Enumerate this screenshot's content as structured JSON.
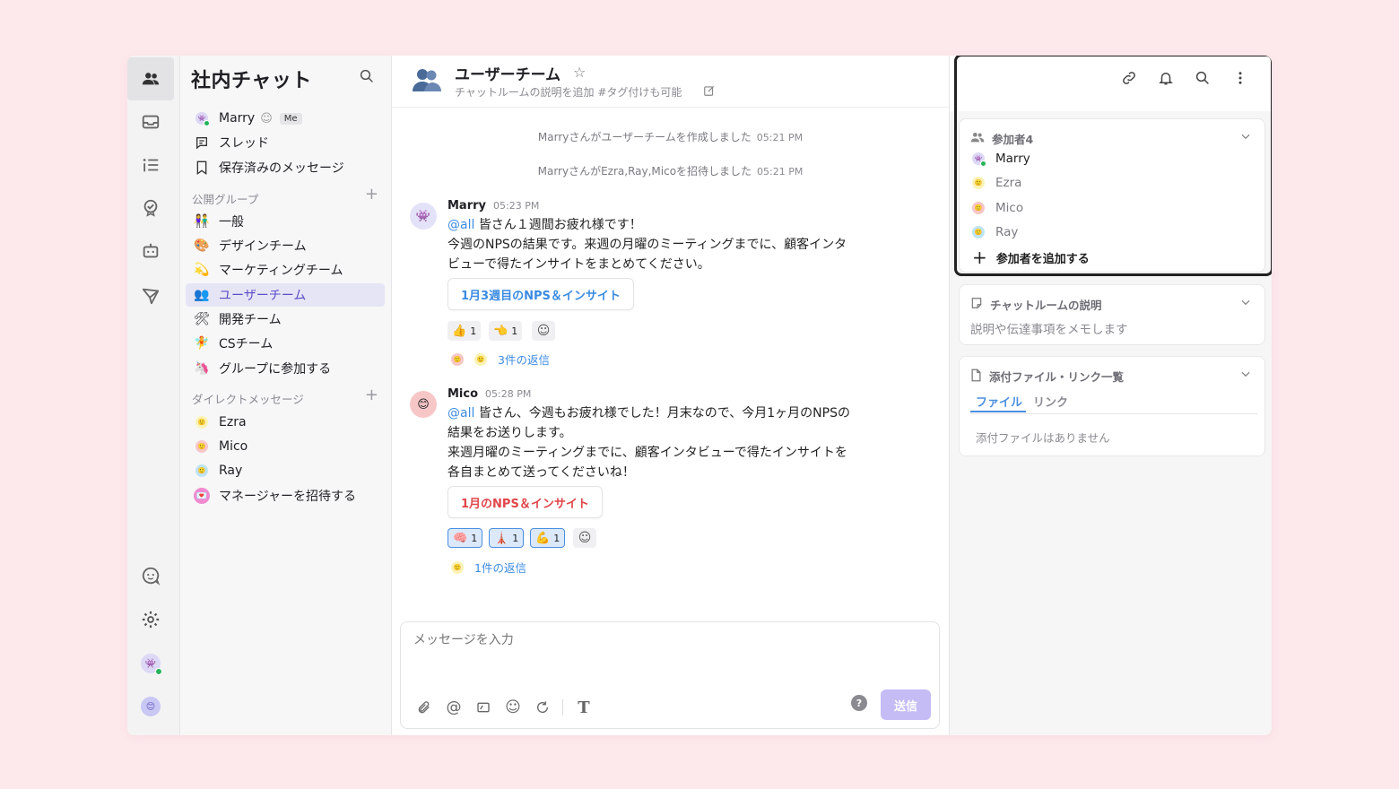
{
  "workspace": {
    "title": "社内チャット"
  },
  "sidebar": {
    "me": {
      "name": "Marry",
      "badge": "Me"
    },
    "top_items": [
      {
        "label": "スレッド"
      },
      {
        "label": "保存済みのメッセージ"
      }
    ],
    "public_section": "公開グループ",
    "groups": [
      {
        "label": "一般",
        "emoji": "👫"
      },
      {
        "label": "デザインチーム",
        "emoji": "🎨"
      },
      {
        "label": "マーケティングチーム",
        "emoji": "💫"
      },
      {
        "label": "ユーザーチーム",
        "emoji": "👥"
      },
      {
        "label": "開発チーム",
        "emoji": "🛠"
      },
      {
        "label": "CSチーム",
        "emoji": "🧚"
      },
      {
        "label": "グループに参加する",
        "emoji": "🦄"
      }
    ],
    "dm_section": "ダイレクトメッセージ",
    "dms": [
      {
        "label": "Ezra"
      },
      {
        "label": "Mico"
      },
      {
        "label": "Ray"
      },
      {
        "label": "マネージャーを招待する"
      }
    ]
  },
  "channel": {
    "name": "ユーザーチーム",
    "description": "チャットルームの説明を追加 #タグ付けも可能"
  },
  "system_messages": [
    {
      "text": "Marryさんがユーザーチームを作成しました",
      "time": "05:21 PM"
    },
    {
      "text": "MarryさんがEzra,Ray,Micoを招待しました",
      "time": "05:21 PM"
    }
  ],
  "messages": [
    {
      "author": "Marry",
      "time": "05:23 PM",
      "mention": "@all",
      "line1": " 皆さん１週間お疲れ様です！",
      "line2": "今週のNPSの結果です。来週の月曜のミーティングまでに、顧客インタ",
      "line3": "ビューで得たインサイトをまとめてください。",
      "card": "1月3週目のNPS＆インサイト",
      "reactions": [
        {
          "emoji": "👍",
          "count": "1"
        },
        {
          "emoji": "👈",
          "count": "1"
        }
      ],
      "replies": "3件の返信"
    },
    {
      "author": "Mico",
      "time": "05:28 PM",
      "mention": "@all",
      "line1": " 皆さん、今週もお疲れ様でした！月末なので、今月1ヶ月のNPSの",
      "line2": "結果をお送りします。",
      "line3": "来週月曜のミーティングまでに、顧客インタビューで得たインサイトを",
      "line4": "各自まとめて送ってくださいね！",
      "card": "1月のNPS＆インサイト",
      "reactions": [
        {
          "emoji": "🧠",
          "count": "1"
        },
        {
          "emoji": "🗼",
          "count": "1"
        },
        {
          "emoji": "💪",
          "count": "1"
        }
      ],
      "replies": "1件の返信"
    }
  ],
  "composer": {
    "placeholder": "メッセージを入力",
    "send_label": "送信",
    "help": "?"
  },
  "right_panel": {
    "members_title": "参加者4",
    "members": [
      {
        "name": "Marry"
      },
      {
        "name": "Ezra"
      },
      {
        "name": "Mico"
      },
      {
        "name": "Ray"
      }
    ],
    "add_member": "参加者を追加する",
    "desc_title": "チャットルームの説明",
    "desc_placeholder": "説明や伝達事項をメモします",
    "files_title": "添付ファイル・リンク一覧",
    "tab_files": "ファイル",
    "tab_links": "リンク",
    "files_empty": "添付ファイルはありません"
  },
  "colors": {
    "accent": "#5a4ec7",
    "link": "#3b8be0",
    "card_blue": "#3b8be0",
    "card_red": "#e0464a",
    "send": "#c5bcf5"
  }
}
